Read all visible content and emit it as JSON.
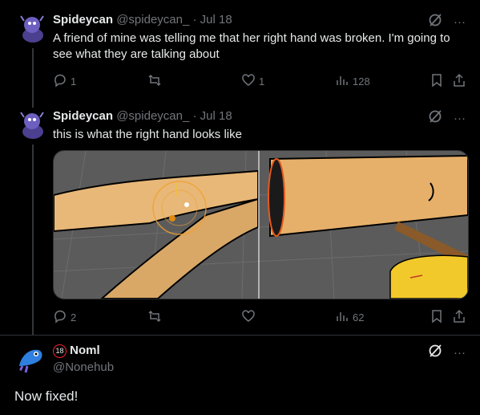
{
  "tweets": [
    {
      "name": "Spideycan",
      "handle": "@spideycan_",
      "sep": "·",
      "date": "Jul 18",
      "text": "A friend of mine was telling me that her right hand was broken. I'm going to see what they are talking about",
      "replies": "1",
      "retweets": "",
      "likes": "1",
      "views": "128"
    },
    {
      "name": "Spideycan",
      "handle": "@spideycan_",
      "sep": "·",
      "date": "Jul 18",
      "text": "this is what the right hand looks like",
      "replies": "2",
      "retweets": "",
      "likes": "",
      "views": "62"
    }
  ],
  "reply": {
    "badge": "18",
    "name": "Noml",
    "handle": "@Nonehub",
    "text": "Now fixed!"
  },
  "more_label": "···",
  "colors": {
    "background": "#000000",
    "text": "#e7e9ea",
    "muted": "#71767b",
    "border": "#2f3336",
    "badge_red": "#f4212e",
    "skin": "#e8b878",
    "avatar_purple": "#5a4ea8",
    "avatar_blue": "#2f7fe0"
  },
  "icons": [
    "grok-slash-icon",
    "more-icon",
    "reply-icon",
    "retweet-icon",
    "like-icon",
    "views-icon",
    "bookmark-icon",
    "share-icon"
  ]
}
